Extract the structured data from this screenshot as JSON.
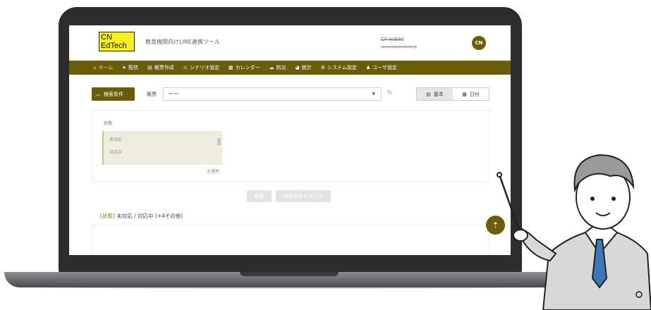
{
  "logo": {
    "line1": "CN",
    "line2": "EdTech"
  },
  "header": {
    "app_title": "教育機関向けLINE連携ツール",
    "user_name": "CF-HIBIKI",
    "user_email": "sample@cfedtech.jp",
    "avatar_initials": "CN"
  },
  "nav": [
    {
      "icon": "home-icon",
      "glyph": "⌂",
      "label": "ホーム"
    },
    {
      "icon": "broadcast-icon",
      "glyph": "➤",
      "label": "配信"
    },
    {
      "icon": "form-icon",
      "glyph": "▤",
      "label": "帳票作成"
    },
    {
      "icon": "scenario-icon",
      "glyph": "⚠",
      "label": "シナリオ設定"
    },
    {
      "icon": "calendar-icon",
      "glyph": "▦",
      "label": "カレンダー"
    },
    {
      "icon": "disaster-icon",
      "glyph": "☁",
      "label": "防災"
    },
    {
      "icon": "stats-icon",
      "glyph": "◕",
      "label": "統計"
    },
    {
      "icon": "system-settings-icon",
      "glyph": "⚙",
      "label": "システム設定"
    },
    {
      "icon": "user-settings-icon",
      "glyph": "♟",
      "label": "ユーザ設定"
    }
  ],
  "toolbar": {
    "search_toggle_label": "検索条件",
    "form_label": "帳票",
    "form_select_value": "ーー",
    "view_basic_label": "基本",
    "view_date_label": "日付"
  },
  "filter": {
    "status_label": "状態",
    "status_options": [
      "未対応",
      "対応中"
    ],
    "select_all_label": "全選択"
  },
  "buttons": {
    "search_label": "検索",
    "clear_label": "検索条件をクリア"
  },
  "summary": {
    "key": "[状態]",
    "value": "未対応 / 対応中 (+4その他)"
  },
  "colors": {
    "brand": "#695d0b",
    "logo_yellow": "#f6ef1f",
    "accent_active": "#f5e100"
  }
}
